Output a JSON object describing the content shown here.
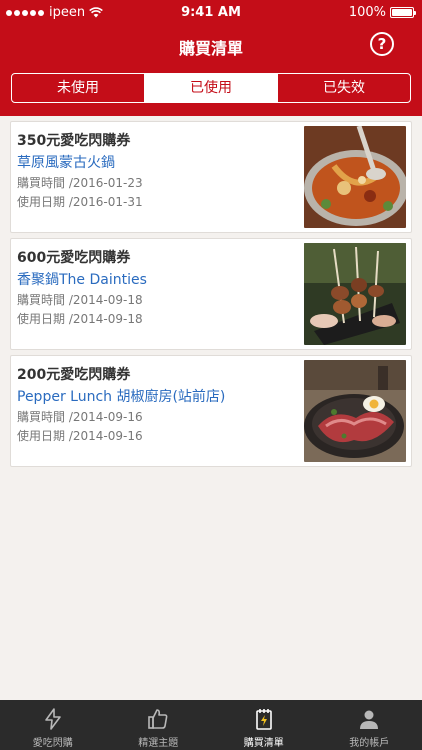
{
  "status_bar": {
    "carrier": "ipeen",
    "time": "9:41 AM",
    "battery": "100%"
  },
  "nav": {
    "title": "購買清單",
    "help_label": "?"
  },
  "segments": [
    {
      "label": "未使用",
      "active": false
    },
    {
      "label": "已使用",
      "active": true
    },
    {
      "label": "已失效",
      "active": false
    }
  ],
  "vouchers": [
    {
      "title": "350元愛吃閃購券",
      "store": "草原風蒙古火鍋",
      "purchase_label": "購買時間",
      "purchase_date": "2016-01-23",
      "use_label": "使用日期",
      "use_date": "2016-01-31",
      "image_icon": "hotpot-photo"
    },
    {
      "title": "600元愛吃閃購券",
      "store": "香聚鍋The Dainties",
      "purchase_label": "購買時間",
      "purchase_date": "2014-09-18",
      "use_label": "使用日期",
      "use_date": "2014-09-18",
      "image_icon": "skewers-photo"
    },
    {
      "title": "200元愛吃閃購券",
      "store": "Pepper Lunch 胡椒廚房(站前店)",
      "purchase_label": "購買時間",
      "purchase_date": "2014-09-16",
      "use_label": "使用日期",
      "use_date": "2014-09-16",
      "image_icon": "beef-hotplate-photo"
    }
  ],
  "tabbar": [
    {
      "label": "愛吃閃購",
      "icon": "lightning-icon",
      "active": false
    },
    {
      "label": "精選主題",
      "icon": "thumbs-up-icon",
      "active": false
    },
    {
      "label": "購買清單",
      "icon": "receipt-icon",
      "active": true
    },
    {
      "label": "我的帳戶",
      "icon": "person-icon",
      "active": false
    }
  ],
  "colors": {
    "brand_red": "#c40d18",
    "link_blue": "#2a6bbf",
    "tabbar_bg": "#2b2b2b",
    "page_bg": "#f4f1ee"
  }
}
